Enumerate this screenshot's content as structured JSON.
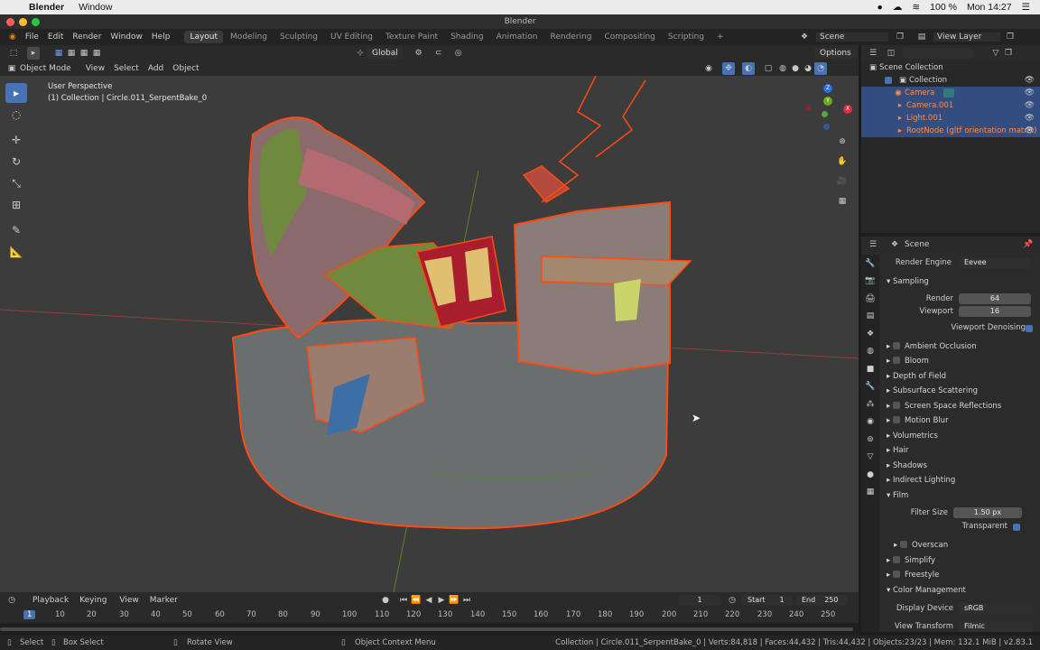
{
  "mac_menu": {
    "app": "Blender",
    "window": "Window",
    "battery": "100 %",
    "clock": "Mon 14:27"
  },
  "title": "Blender",
  "topmenu": [
    "File",
    "Edit",
    "Render",
    "Window",
    "Help"
  ],
  "workspaces": [
    "Layout",
    "Modeling",
    "Sculpting",
    "UV Editing",
    "Texture Paint",
    "Shading",
    "Animation",
    "Rendering",
    "Compositing",
    "Scripting"
  ],
  "add_workspace": "+",
  "scene_name": "Scene",
  "view_layer": "View Layer",
  "viewport": {
    "mode": "Object Mode",
    "menus": [
      "View",
      "Select",
      "Add",
      "Object"
    ],
    "orientation": "Global",
    "options": "Options",
    "perspective": "User Perspective",
    "collection_info": "(1) Collection | Circle.011_SerpentBake_0",
    "gizmo": {
      "z": "Z",
      "y": "Y",
      "x": "X"
    },
    "colors": {
      "bg": "#3c3c3c",
      "selection": "#ff4a12",
      "x_axis": "#b43c3c",
      "y_axis": "#6a9a1f"
    }
  },
  "outliner": {
    "root": "Scene Collection",
    "collection": "Collection",
    "items": [
      "Camera",
      "Camera.001",
      "Light.001",
      "RootNode (gltf orientation matrix)"
    ]
  },
  "properties": {
    "context": "Scene",
    "render_engine_label": "Render Engine",
    "render_engine": "Eevee",
    "sampling": "Sampling",
    "render_label": "Render",
    "render_samples": "64",
    "viewport_label": "Viewport",
    "viewport_samples": "16",
    "viewport_denoising": "Viewport Denoising",
    "sections": [
      "Ambient Occlusion",
      "Bloom",
      "Depth of Field",
      "Subsurface Scattering",
      "Screen Space Reflections",
      "Motion Blur",
      "Volumetrics",
      "Hair",
      "Shadows",
      "Indirect Lighting",
      "Film"
    ],
    "filter_size_label": "Filter Size",
    "filter_size": "1.50 px",
    "transparent": "Transparent",
    "overscan": "Overscan",
    "sections2": [
      "Simplify",
      "Freestyle",
      "Color Management"
    ],
    "display_device_label": "Display Device",
    "display_device": "sRGB",
    "view_transform_label": "View Transform",
    "view_transform": "Filmic"
  },
  "timeline": {
    "menus": [
      "Playback",
      "Keying",
      "View",
      "Marker"
    ],
    "current_frame": "1",
    "start_label": "Start",
    "start": "1",
    "end_label": "End",
    "end": "250",
    "ticks": [
      "1",
      "10",
      "20",
      "30",
      "40",
      "50",
      "60",
      "70",
      "80",
      "90",
      "100",
      "110",
      "120",
      "130",
      "140",
      "150",
      "160",
      "170",
      "180",
      "190",
      "200",
      "210",
      "220",
      "230",
      "240",
      "250"
    ]
  },
  "status": {
    "select": "Select",
    "box_select": "Box Select",
    "rotate": "Rotate View",
    "context_menu": "Object Context Menu",
    "stats": "Collection | Circle.011_SerpentBake_0 | Verts:84,818 | Faces:44,432 | Tris:44,432 | Objects:23/23 | Mem: 132.1 MiB | v2.83.1"
  }
}
